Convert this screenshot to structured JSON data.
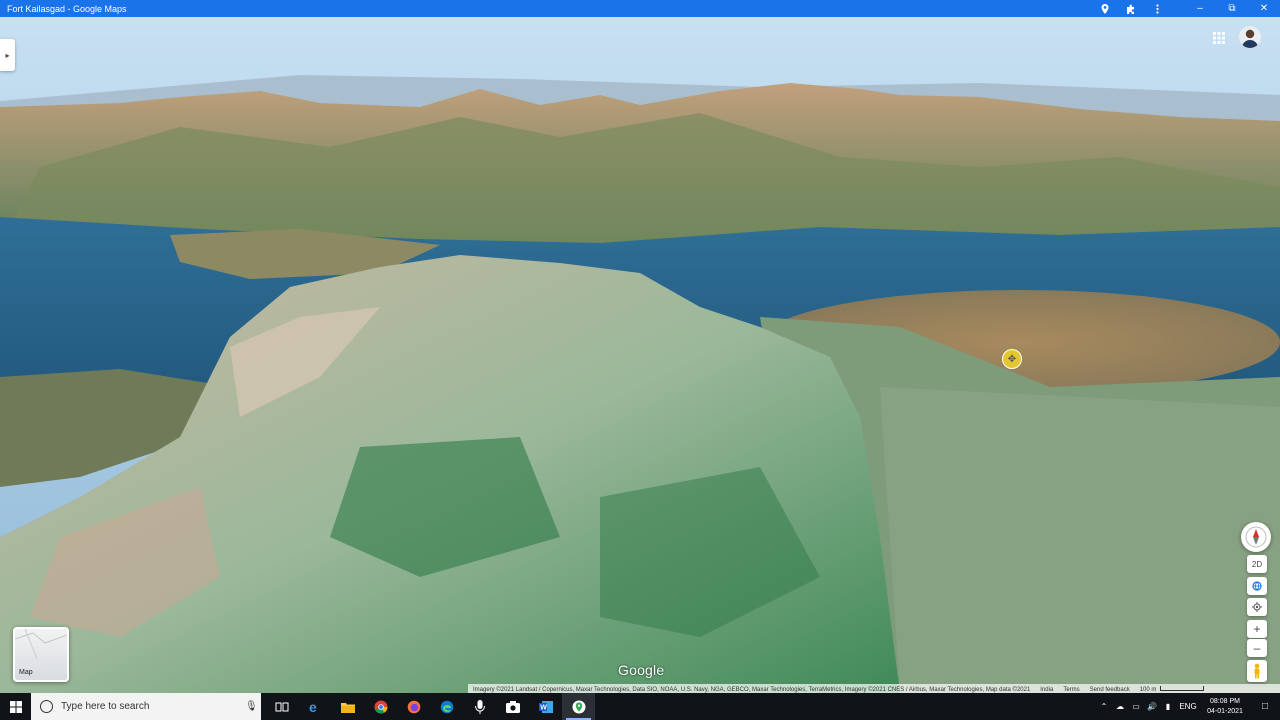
{
  "window": {
    "title": "Fort Kailasgad - Google Maps"
  },
  "map": {
    "google_label": "Google",
    "layer_thumbnail_label": "Map",
    "view_mode": "2D",
    "attribution": "Imagery ©2021 Landsat / Copernicus, Maxar Technologies, Data SIO, NOAA, U.S. Navy, NGA, GEBCO, Maxar Technologies, TerraMetrics, Imagery ©2021 CNES / Airbus, Maxar Technologies, Map data ©2021",
    "region": "India",
    "terms": "Terms",
    "feedback": "Send feedback",
    "scale": "100 m"
  },
  "taskbar": {
    "search_placeholder": "Type here to search",
    "language": "ENG",
    "time": "08:08 PM",
    "date": "04-01-2021"
  },
  "colors": {
    "titlebar": "#1a73e8",
    "taskbar": "#101318"
  }
}
